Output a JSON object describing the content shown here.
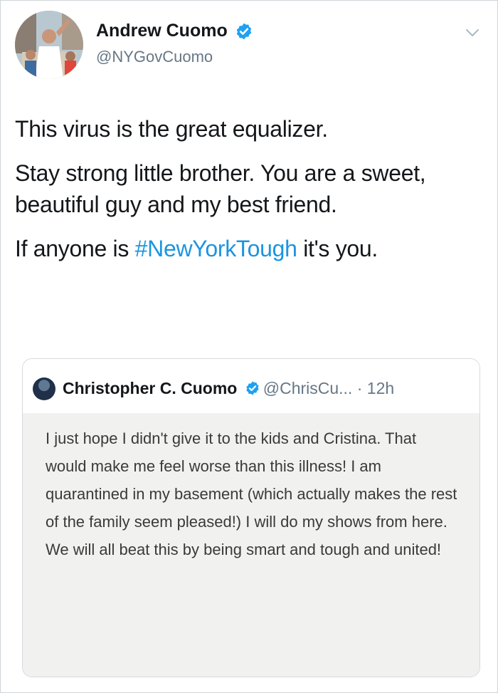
{
  "tweet": {
    "author_name": "Andrew Cuomo",
    "author_handle": "@NYGovCuomo",
    "paragraphs": {
      "p1": "This virus is the great equalizer.",
      "p2": "Stay strong little brother. You are a sweet, beautiful guy and my best friend.",
      "p3_before": "If anyone is ",
      "p3_hashtag": "#NewYorkTough",
      "p3_after": " it's you."
    },
    "icons": {
      "verified": "verified-badge-icon",
      "more": "chevron-down-icon",
      "avatar": "avatar"
    }
  },
  "quoted_tweet": {
    "author_name": "Christopher C. Cuomo",
    "author_handle": "@ChrisCu...",
    "separator": " · ",
    "time": "12h",
    "text": "I just hope I didn't give it to the kids and Cristina. That would make me feel worse than this illness! I am quarantined in my basement (which actually makes the rest of the family seem pleased!) I will do my shows from here. We will all beat this by being smart and tough and united!"
  },
  "colors": {
    "accent": "#1b95e0",
    "verified": "#1da1f2",
    "secondary_text": "#657786",
    "quote_background": "#f1f1ef"
  }
}
